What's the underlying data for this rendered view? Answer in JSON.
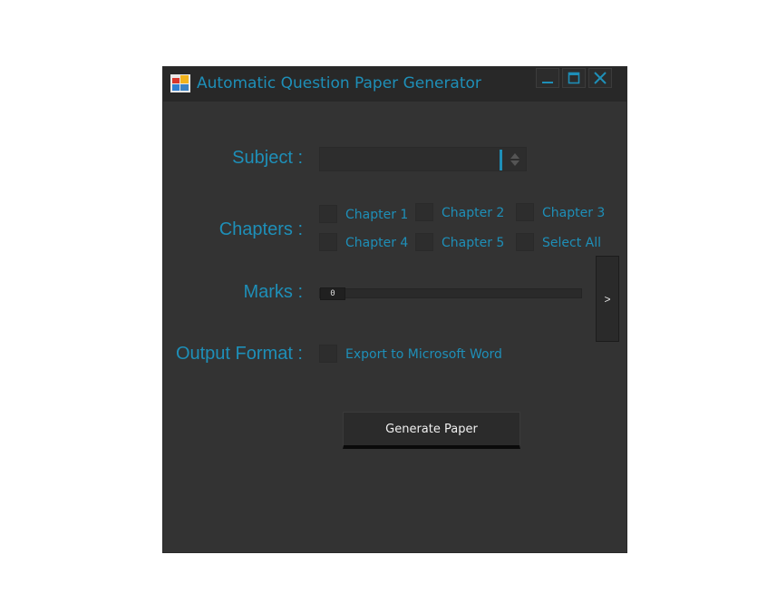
{
  "window": {
    "title": "Automatic Question Paper Generator",
    "icon": "app-icon",
    "controls": {
      "minimize": "minimize-icon",
      "maximize": "maximize-icon",
      "close": "close-icon"
    }
  },
  "form": {
    "subject_label": "Subject :",
    "subject_value": "",
    "chapters_label": "Chapters :",
    "chapters": [
      {
        "label": "Chapter 1",
        "checked": false
      },
      {
        "label": "Chapter 2",
        "checked": false
      },
      {
        "label": "Chapter 3",
        "checked": false
      },
      {
        "label": "Chapter 4",
        "checked": false
      },
      {
        "label": "Chapter 5",
        "checked": false
      },
      {
        "label": "Select All",
        "checked": false
      }
    ],
    "marks_label": "Marks :",
    "marks_value": "0",
    "next_label": ">",
    "output_label": "Output Format :",
    "export_label": "Export to Microsoft Word",
    "generate_label": "Generate Paper"
  },
  "colors": {
    "accent": "#1e8fb8",
    "window_bg": "#333333",
    "titlebar_bg": "#282828"
  }
}
